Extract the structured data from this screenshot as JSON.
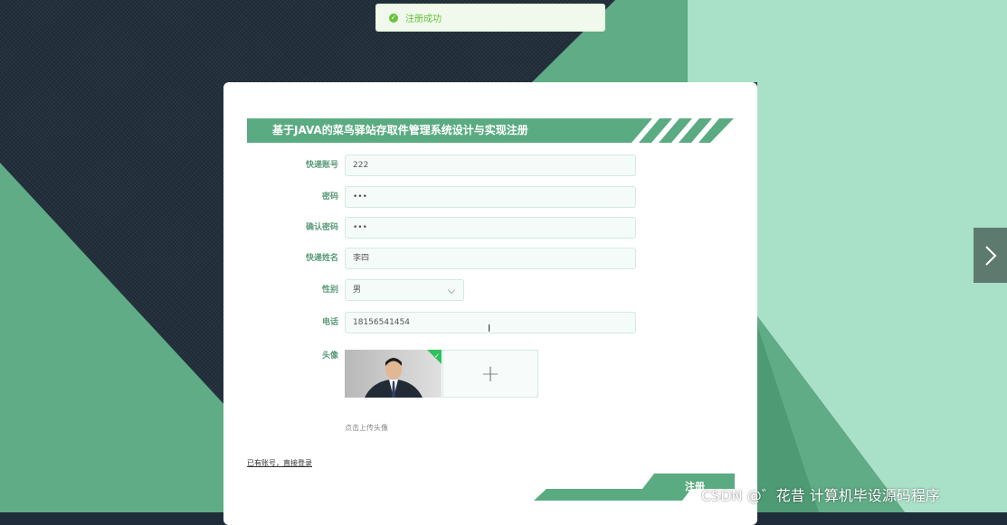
{
  "toast": {
    "message": "注册成功",
    "color": "#67c23a"
  },
  "form": {
    "title": "基于JAVA的菜鸟驿站存取件管理系统设计与实现注册",
    "fields": [
      {
        "label": "快递账号",
        "value": "222"
      },
      {
        "label": "密码",
        "value": "•••"
      },
      {
        "label": "确认密码",
        "value": "•••"
      },
      {
        "label": "快递姓名",
        "value": "李四"
      },
      {
        "label": "性别",
        "value": "男"
      },
      {
        "label": "电话",
        "value": "18156541454"
      }
    ],
    "avatar_label": "头像",
    "upload_hint": "点击上传头像",
    "login_link": "已有账号，直接登录",
    "register_label": "注册"
  },
  "watermark": "CSDN @゛花昔  计算机毕设源码程序",
  "colors": {
    "accent": "#5bab82",
    "light_green": "#a9e0c9",
    "dark_bg": "#1e2b37"
  }
}
